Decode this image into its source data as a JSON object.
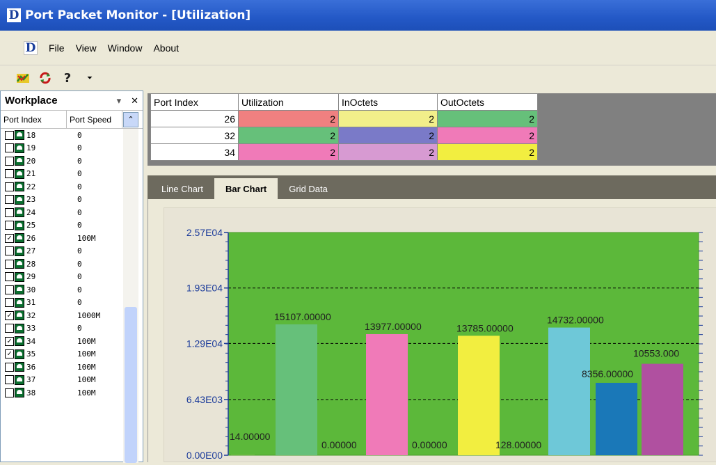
{
  "window": {
    "title": "Port Packet Monitor - [Utilization]",
    "logo_letter": "D"
  },
  "menu": {
    "items": [
      "File",
      "View",
      "Window",
      "About"
    ]
  },
  "toolbar": {
    "icons": [
      "chart-icon",
      "refresh-icon",
      "help-icon",
      "dropdown-icon"
    ]
  },
  "workplace": {
    "title": "Workplace",
    "columns": [
      "Port Index",
      "Port Speed"
    ],
    "rows": [
      {
        "idx": "18",
        "speed": "0",
        "checked": false
      },
      {
        "idx": "19",
        "speed": "0",
        "checked": false
      },
      {
        "idx": "20",
        "speed": "0",
        "checked": false
      },
      {
        "idx": "21",
        "speed": "0",
        "checked": false
      },
      {
        "idx": "22",
        "speed": "0",
        "checked": false
      },
      {
        "idx": "23",
        "speed": "0",
        "checked": false
      },
      {
        "idx": "24",
        "speed": "0",
        "checked": false
      },
      {
        "idx": "25",
        "speed": "0",
        "checked": false
      },
      {
        "idx": "26",
        "speed": "100M",
        "checked": true
      },
      {
        "idx": "27",
        "speed": "0",
        "checked": false
      },
      {
        "idx": "28",
        "speed": "0",
        "checked": false
      },
      {
        "idx": "29",
        "speed": "0",
        "checked": false
      },
      {
        "idx": "30",
        "speed": "0",
        "checked": false
      },
      {
        "idx": "31",
        "speed": "0",
        "checked": false
      },
      {
        "idx": "32",
        "speed": "1000M",
        "checked": true
      },
      {
        "idx": "33",
        "speed": "0",
        "checked": false
      },
      {
        "idx": "34",
        "speed": "100M",
        "checked": true
      },
      {
        "idx": "35",
        "speed": "100M",
        "checked": true
      },
      {
        "idx": "36",
        "speed": "100M",
        "checked": false
      },
      {
        "idx": "37",
        "speed": "100M",
        "checked": false
      },
      {
        "idx": "38",
        "speed": "100M",
        "checked": false
      }
    ]
  },
  "grid": {
    "headers": [
      "Port Index",
      "Utilization",
      "InOctets",
      "OutOctets"
    ],
    "rows": [
      {
        "port": "26",
        "util": "2",
        "in": "2",
        "out": "2",
        "colors": [
          "#f08080",
          "#f2ef8a",
          "#66c07a"
        ]
      },
      {
        "port": "32",
        "util": "2",
        "in": "2",
        "out": "2",
        "colors": [
          "#66c07a",
          "#7a7ac8",
          "#f07ab8"
        ]
      },
      {
        "port": "34",
        "util": "2",
        "in": "2",
        "out": "2",
        "colors": [
          "#f07ab8",
          "#d79ad2",
          "#f2ee40"
        ]
      }
    ]
  },
  "tabs": [
    "Line Chart",
    "Bar Chart",
    "Grid Data"
  ],
  "active_tab": "Bar Chart",
  "chart_data": {
    "type": "bar",
    "ylim": [
      0,
      25700
    ],
    "ytick_labels": [
      "0.00E00",
      "6.43E03",
      "1.29E04",
      "1.93E04",
      "2.57E04"
    ],
    "ytick_values": [
      0,
      6430,
      12900,
      19300,
      25700
    ],
    "grid": true,
    "background": "#5cb83a",
    "bars": [
      {
        "value": 14,
        "label": "14.00000",
        "color": "#f2ef8a"
      },
      {
        "value": 15107,
        "label": "15107.00000",
        "color": "#66c07a"
      },
      {
        "value": 0,
        "label": "0.00000",
        "color": "#66c07a"
      },
      {
        "value": 13977,
        "label": "13977.00000",
        "color": "#f07ab8"
      },
      {
        "value": 0,
        "label": "0.00000",
        "color": "#f07ab8"
      },
      {
        "value": 13785,
        "label": "13785.00000",
        "color": "#f2ee40"
      },
      {
        "value": 128,
        "label": "128.00000",
        "color": "#f2ee40"
      },
      {
        "value": 14732,
        "label": "14732.00000",
        "color": "#6ec8d8"
      },
      {
        "value": 8356,
        "label": "8356.00000",
        "color": "#1a78b8"
      },
      {
        "value": 10553,
        "label": "10553.000",
        "color": "#b050a0"
      }
    ]
  }
}
